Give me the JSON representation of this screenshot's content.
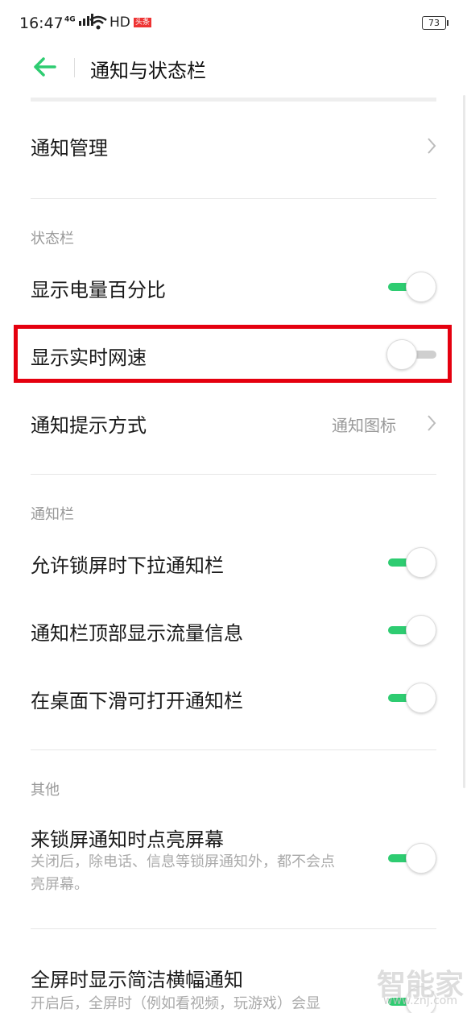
{
  "status_bar": {
    "time": "16:47",
    "network": "4G",
    "hd": "HD",
    "badge": "头条",
    "battery": "73"
  },
  "header": {
    "title": "通知与状态栏"
  },
  "items": {
    "notification_management": {
      "label": "通知管理"
    },
    "section_status_bar": "状态栏",
    "show_battery_percent": {
      "label": "显示电量百分比",
      "enabled": true
    },
    "show_network_speed": {
      "label": "显示实时网速",
      "enabled": false
    },
    "notification_style": {
      "label": "通知提示方式",
      "value": "通知图标"
    },
    "section_notification_bar": "通知栏",
    "pull_down_lockscreen": {
      "label": "允许锁屏时下拉通知栏",
      "enabled": true
    },
    "show_data_usage": {
      "label": "通知栏顶部显示流量信息",
      "enabled": true
    },
    "swipe_down_desktop": {
      "label": "在桌面下滑可打开通知栏",
      "enabled": true
    },
    "section_other": "其他",
    "wake_screen": {
      "label": "来锁屏通知时点亮屏幕",
      "desc": "关闭后，除电话、信息等锁屏通知外，都不会点亮屏幕。",
      "enabled": true
    },
    "banner_fullscreen": {
      "label": "全屏时显示简洁横幅通知",
      "desc": "开启后，全屏时（例如看视频，玩游戏）会显",
      "enabled": true
    }
  },
  "watermark": {
    "text": "智能家",
    "url": "www.znj.com"
  },
  "colors": {
    "accent": "#2ecc71",
    "highlight": "#e5000f"
  }
}
